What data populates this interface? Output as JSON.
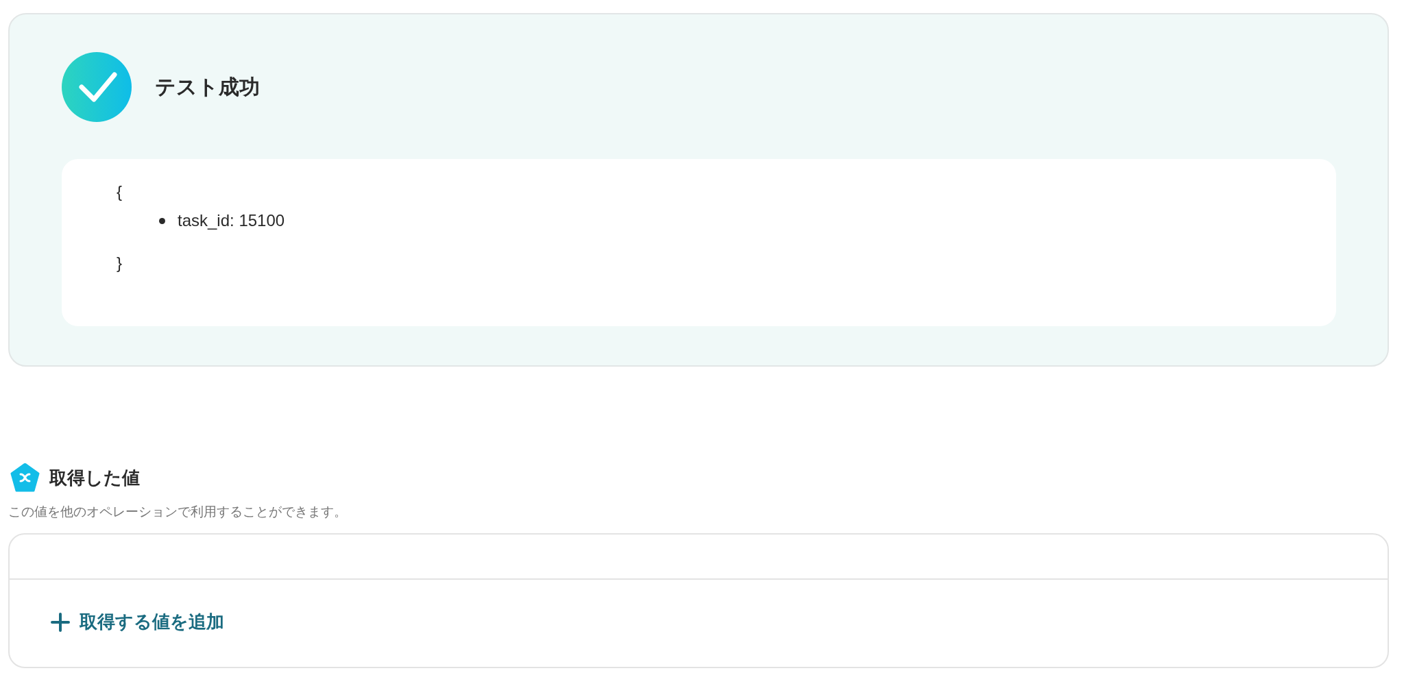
{
  "test_result": {
    "passed": true,
    "title": "テスト成功",
    "output": {
      "open": "{",
      "items": [
        "task_id: 15100"
      ],
      "close": "}"
    }
  },
  "acquired_values": {
    "title": "取得した値",
    "description": "この値を他のオペレーションで利用することができます。",
    "add_button": "取得する値を追加"
  }
}
